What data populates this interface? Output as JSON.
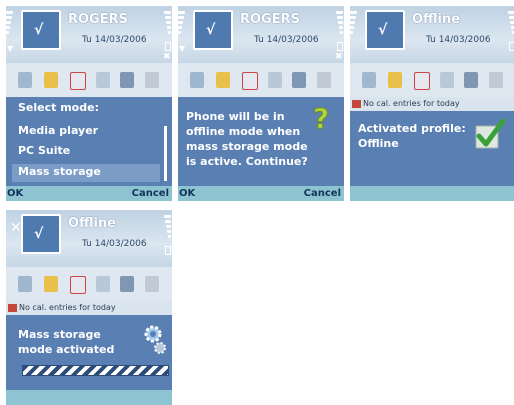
{
  "screens": [
    {
      "operator": "ROGERS",
      "date": "Tu 14/03/2006",
      "heading": "Select mode:",
      "items": [
        "Media player",
        "PC Suite",
        "Mass storage"
      ],
      "selected_index": 2,
      "softkey_left": "OK",
      "softkey_right": "Cancel"
    },
    {
      "operator": "ROGERS",
      "date": "Tu 14/03/2006",
      "message": "Phone will be in offline mode when mass storage mode is active. Continue?",
      "icon": "question-mark-icon",
      "softkey_left": "OK",
      "softkey_right": "Cancel"
    },
    {
      "operator": "Offline",
      "date": "Tu 14/03/2006",
      "band": "No cal. entries for today",
      "message": "Activated profile: Offline",
      "icon": "checkmark-icon"
    },
    {
      "operator": "Offline",
      "date": "Tu 14/03/2006",
      "band": "No cal. entries for today",
      "message": "Mass storage mode activated",
      "icon": "gear-icon",
      "progress": 1.0
    }
  ],
  "colors": {
    "screen_blue": "#5a7fb3",
    "softkey_bar": "#8ec3d1",
    "highlight": "#7b9cc7"
  }
}
